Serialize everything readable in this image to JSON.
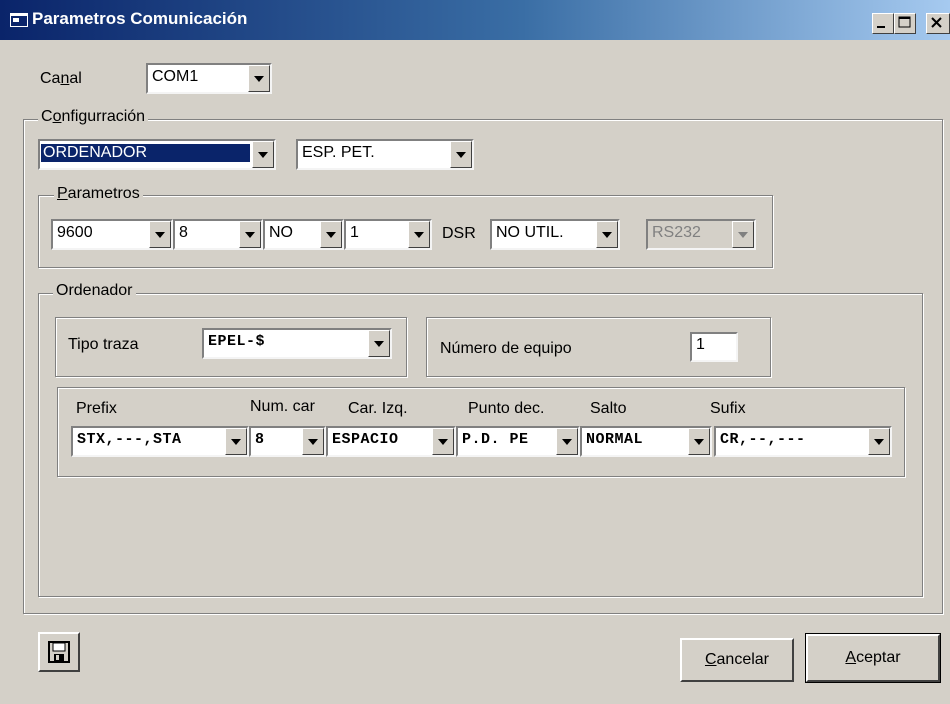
{
  "window": {
    "title": "Parametros Comunicación",
    "controls": [
      "minimize",
      "maximize",
      "close"
    ]
  },
  "canal": {
    "label_pre": "Ca",
    "label_u": "n",
    "label_post": "al",
    "value": "COM1"
  },
  "configuracion": {
    "legend_pre": "C",
    "legend_u": "o",
    "legend_post": "nfigurración",
    "mode": "ORDENADOR",
    "type": "ESP. PET."
  },
  "parametros": {
    "legend_u": "P",
    "legend_post": "arametros",
    "baud": "9600",
    "bits": "8",
    "parity": "NO",
    "stop": "1",
    "dsr_label": "DSR",
    "dsr": "NO UTIL.",
    "interface": "RS232"
  },
  "ordenador": {
    "legend": "Ordenador",
    "tipo_traza_label": "Tipo traza",
    "tipo_traza": "EPEL-$",
    "numero_equipo_label": "Número de equipo",
    "numero_equipo": "1",
    "fields": {
      "prefix_label": "Prefix",
      "prefix": "STX,---,STA",
      "numcar_label": "Num. car",
      "numcar": "8",
      "carizq_label": "Car. Izq.",
      "carizq": "ESPACIO",
      "puntodec_label": "Punto dec.",
      "puntodec": "P.D. PE",
      "salto_label": "Salto",
      "salto": "NORMAL",
      "sufix_label": "Sufix",
      "sufix": "CR,--,---"
    }
  },
  "buttons": {
    "save_icon": "floppy-disk-icon",
    "cancel_u": "C",
    "cancel_post": "ancelar",
    "accept_u": "A",
    "accept_post": "ceptar"
  }
}
